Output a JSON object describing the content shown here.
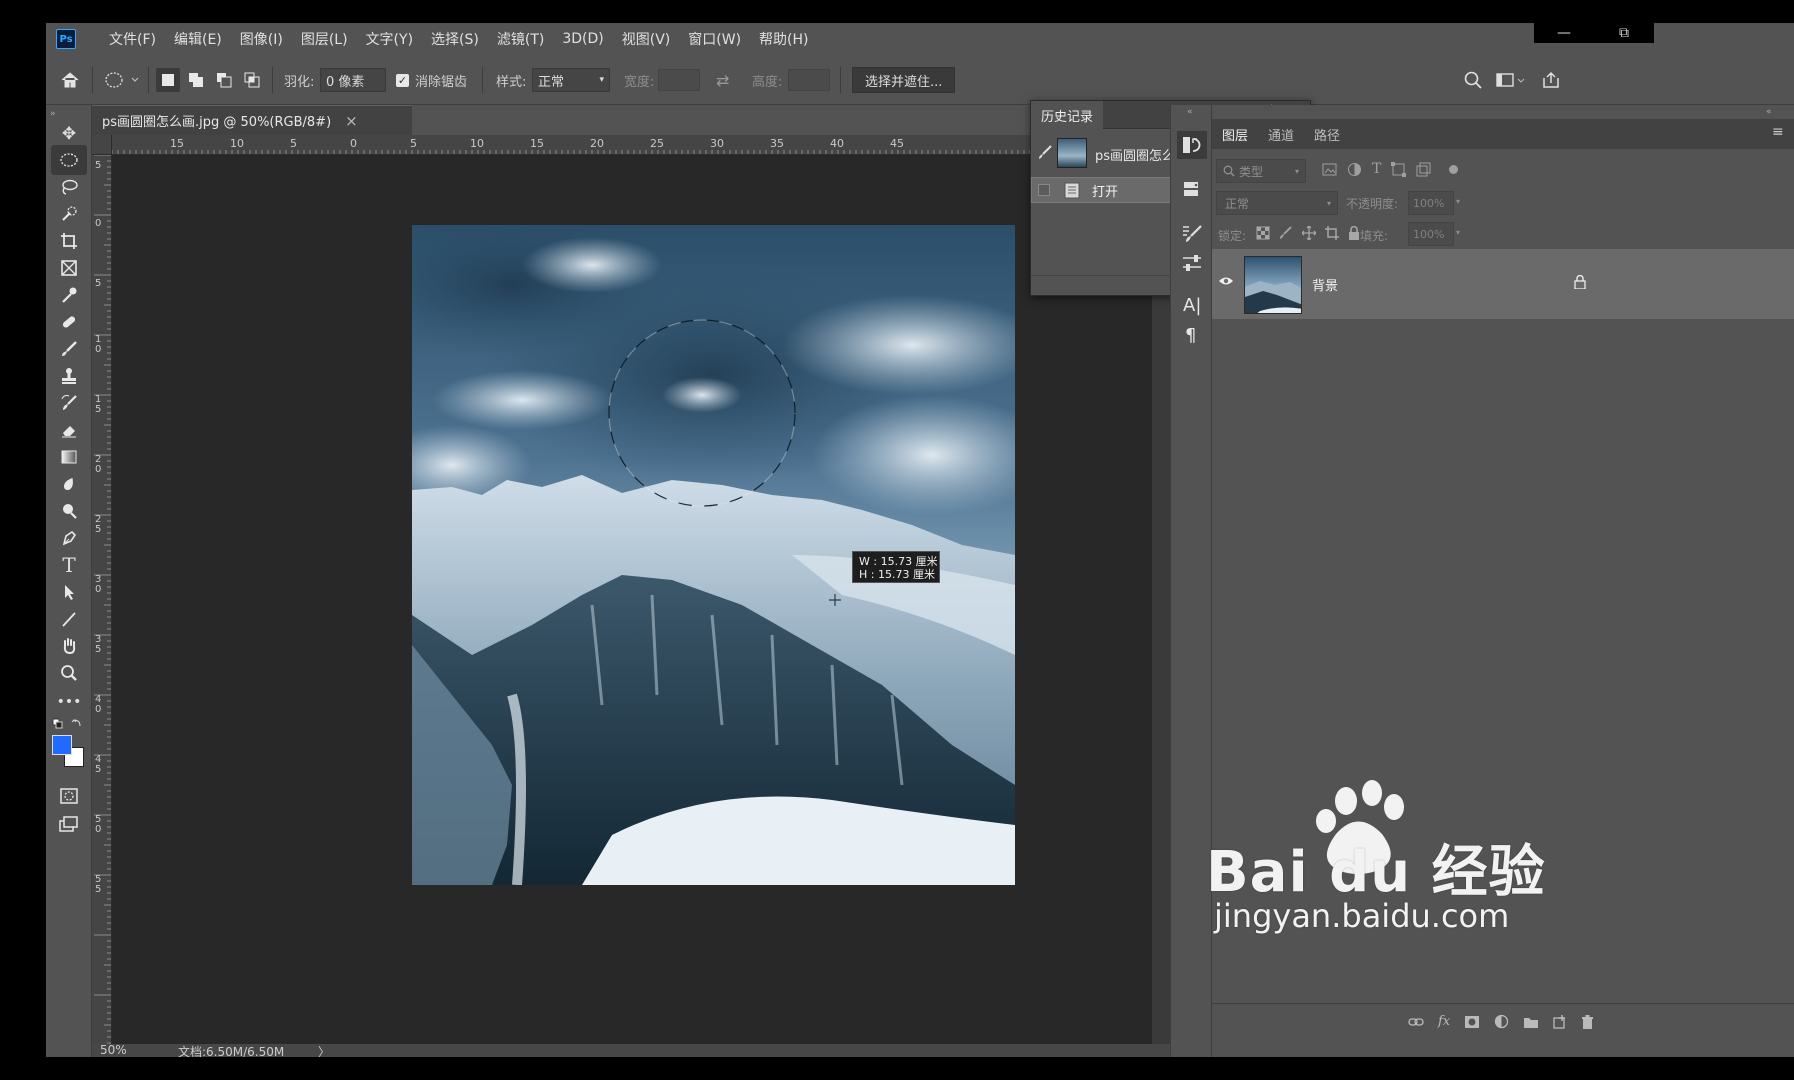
{
  "app": {
    "logo": "Ps"
  },
  "menu": [
    "文件(F)",
    "编辑(E)",
    "图像(I)",
    "图层(L)",
    "文字(Y)",
    "选择(S)",
    "滤镜(T)",
    "3D(D)",
    "视图(V)",
    "窗口(W)",
    "帮助(H)"
  ],
  "window_controls": {
    "minimize": "—",
    "restore": "⧉"
  },
  "options": {
    "feather_label": "羽化:",
    "feather_value": "0 像素",
    "antialias_label": "消除锯齿",
    "antialias_checked": true,
    "style_label": "样式:",
    "style_value": "正常",
    "width_label": "宽度:",
    "height_label": "高度:",
    "select_mask_button": "选择并遮住..."
  },
  "document": {
    "tab_title": "ps画圆圈怎么画.jpg @ 50%(RGB/8#)",
    "close_glyph": "×",
    "ruler_h_labels": [
      "15",
      "10",
      "5",
      "0",
      "5",
      "10",
      "15",
      "20",
      "25",
      "30",
      "35",
      "40",
      "45"
    ],
    "ruler_v_labels": [
      "5",
      "0",
      "5",
      "1 0",
      "1 5",
      "2 0",
      "2 5",
      "3 0",
      "3 5",
      "4 0",
      "4 5",
      "5 0",
      "5 5"
    ],
    "selection_tooltip": {
      "w": "W : 15.73 厘米",
      "h": "H : 15.73 厘米"
    }
  },
  "status": {
    "zoom": "50%",
    "doc_size": "文档:6.50M/6.50M",
    "arrow": "〉"
  },
  "history_panel": {
    "title": "历史记录",
    "snapshot_label": "ps画圆圈怎么画.jpg",
    "items": [
      {
        "label": "打开"
      }
    ]
  },
  "layers_panel": {
    "tabs": [
      "图层",
      "通道",
      "路径"
    ],
    "active_tab": 0,
    "filter_placeholder": "类型",
    "blend_mode": "正常",
    "opacity_label": "不透明度:",
    "opacity_value": "100%",
    "lock_label": "锁定:",
    "fill_label": "填充:",
    "fill_value": "100%",
    "layers": [
      {
        "name": "背景",
        "visible": true,
        "locked": true
      }
    ]
  },
  "watermark": {
    "brand": "Bai du 经验",
    "url": "jingyan.baidu.com"
  },
  "colors": {
    "foreground": "#1f6bff",
    "background": "#ffffff",
    "accent": "#31a8ff"
  }
}
